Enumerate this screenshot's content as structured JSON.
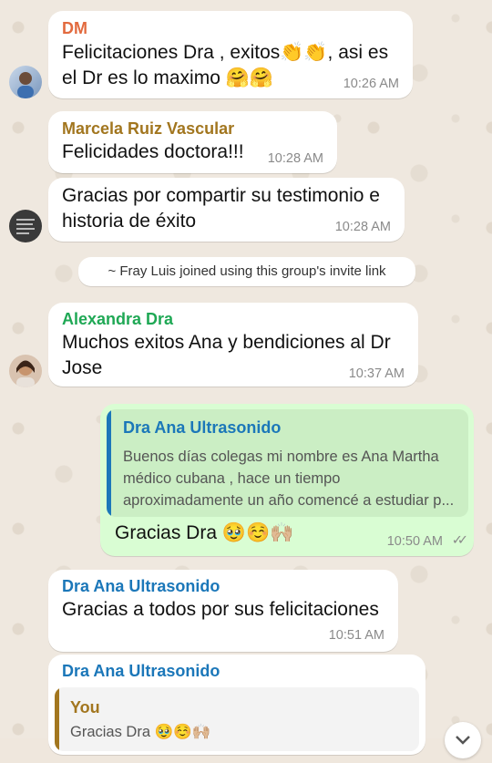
{
  "messages": [
    {
      "sender": "DM",
      "sender_color": "#e26a3e",
      "line1": "Felicitaciones Dra , exitos👏👏, asi es",
      "line2": "el Dr es lo maximo 🤗🤗",
      "time": "10:26 AM"
    },
    {
      "sender": "Marcela Ruiz Vascular",
      "sender_color": "#a2761f",
      "line1": "Felicidades doctora!!!",
      "time": "10:28 AM"
    },
    {
      "line1": "Gracias por compartir su testimonio e",
      "line2": "historia de éxito",
      "time": "10:28 AM"
    },
    {
      "system": "~ Fray Luis joined using this group's invite link"
    },
    {
      "sender": "Alexandra Dra",
      "sender_color": "#1fa855",
      "line1": "Muchos exitos Ana  y bendiciones al Dr",
      "line2": "Jose",
      "time": "10:37 AM"
    },
    {
      "quote_name": "Dra Ana Ultrasonido",
      "quote_line1": "Buenos días colegas mi nombre es Ana Martha",
      "quote_line2": "médico cubana , hace un tiempo",
      "quote_line3": "aproximadamente un año comencé a estudiar p...",
      "line1": "Gracias Dra 🥹☺️🙌🏼",
      "time": "10:50 AM",
      "ticks": "✓✓"
    },
    {
      "sender": "Dra Ana Ultrasonido",
      "sender_color": "#1b77b9",
      "line1": "Gracias a todos por sus felicitaciones",
      "time": "10:51 AM"
    },
    {
      "sender": "Dra Ana Ultrasonido",
      "sender_color": "#1b77b9",
      "quote_name": "You",
      "quote_line1": "Gracias Dra 🥹☺️🙌🏼"
    }
  ],
  "colors": {
    "quote_you": "#a2761f",
    "quote_ana": "#1b77b9",
    "quote_bg_out": "#cbeec4",
    "quote_bg_in": "#f3f3f3"
  }
}
